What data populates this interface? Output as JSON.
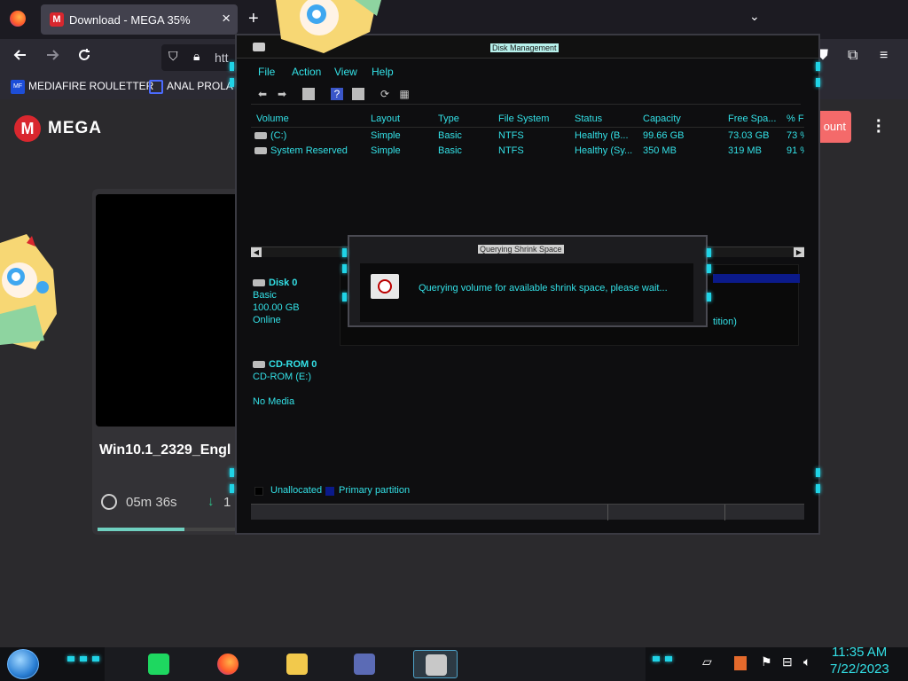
{
  "browser": {
    "tab_title": "Download - MEGA 35%",
    "tab_close": "×",
    "new_tab": "+",
    "tab_list": "⌄",
    "url_partial": "htt",
    "bookmarks": [
      {
        "label": "MEDIAFIRE ROULETTER",
        "icon_text": "MF"
      },
      {
        "label": "ANAL PROLA"
      }
    ]
  },
  "mega": {
    "brand": "MEGA",
    "logo_letter": "M",
    "account_button": "ount",
    "file_name": "Win10.1_2329_Engl",
    "eta": "05m 36s",
    "speed_partial": "1",
    "progress": 0.35
  },
  "disk_management": {
    "title": "Disk Management",
    "menu": [
      "File",
      "Action",
      "View",
      "Help"
    ],
    "columns": [
      "Volume",
      "Layout",
      "Type",
      "File System",
      "Status",
      "Capacity",
      "Free Spa...",
      "% F"
    ],
    "volumes": [
      [
        "(C:)",
        "Simple",
        "Basic",
        "NTFS",
        "Healthy (B...",
        "99.66 GB",
        "73.03 GB",
        "73 %"
      ],
      [
        "System Reserved",
        "Simple",
        "Basic",
        "NTFS",
        "Healthy (Sy...",
        "350 MB",
        "319 MB",
        "91 %"
      ]
    ],
    "disk0": {
      "name": "Disk 0",
      "type": "Basic",
      "size": "100.00 GB",
      "status": "Online",
      "partition_partial": "tition)"
    },
    "cdrom0": {
      "name": "CD-ROM 0",
      "drive": "CD-ROM (E:)",
      "media": "No Media"
    },
    "legend": [
      {
        "label": "Unallocated",
        "color": "#000000"
      },
      {
        "label": "Primary partition",
        "color": "#0b1a8a"
      }
    ]
  },
  "shrink_dialog": {
    "title": "Querying Shrink Space",
    "message": "Querying volume for available shrink space, please wait..."
  },
  "taskbar": {
    "time": "11:35 AM",
    "date": "7/22/2023"
  },
  "colors": {
    "accent_cyan": "#33e0e6",
    "mega_red": "#d9272e"
  }
}
